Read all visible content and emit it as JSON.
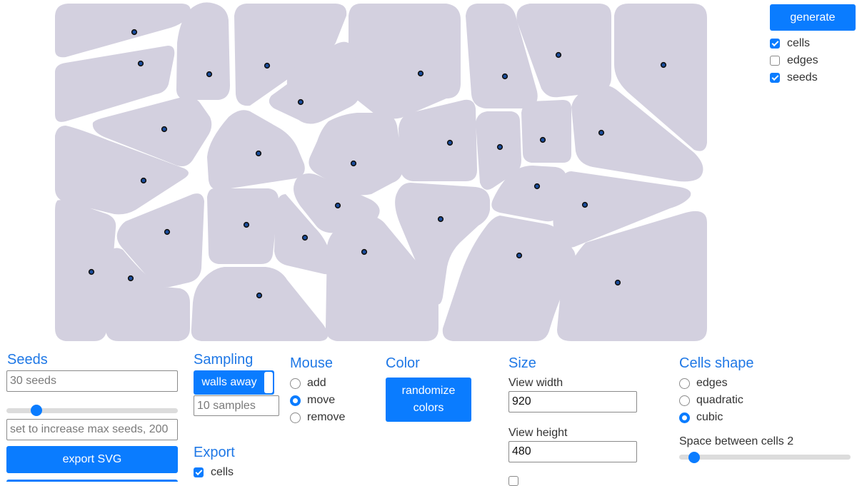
{
  "display": {
    "generate_label": "generate",
    "options": [
      {
        "label": "cells",
        "checked": true
      },
      {
        "label": "edges",
        "checked": false
      },
      {
        "label": "seeds",
        "checked": true
      }
    ]
  },
  "seeds": {
    "heading": "Seeds",
    "count_placeholder": "30 seeds",
    "slider_value": 30,
    "max_placeholder": "set to increase max seeds, 200",
    "export_svg_label": "export SVG"
  },
  "sampling": {
    "heading": "Sampling",
    "mode_label": "walls away",
    "samples_placeholder": "10 samples"
  },
  "export": {
    "heading": "Export",
    "cells_label": "cells",
    "cells_checked": true
  },
  "mouse": {
    "heading": "Mouse",
    "options": [
      {
        "label": "add",
        "selected": false
      },
      {
        "label": "move",
        "selected": true
      },
      {
        "label": "remove",
        "selected": false
      }
    ]
  },
  "color": {
    "heading": "Color",
    "randomize_label": "randomize\ncolors"
  },
  "size": {
    "heading": "Size",
    "view_width_label": "View width",
    "view_width_value": "920",
    "view_height_label": "View height",
    "view_height_value": "480"
  },
  "cells_shape": {
    "heading": "Cells shape",
    "options": [
      {
        "label": "edges",
        "selected": false
      },
      {
        "label": "quadratic",
        "selected": false
      },
      {
        "label": "cubic",
        "selected": true
      }
    ],
    "space_label": "Space between cells 2",
    "space_value": 2
  },
  "colors": {
    "accent": "#0a7cff",
    "heading": "#1f78e6",
    "cell_fill": "#d3d0df",
    "seed_fill": "#1a4d9e"
  },
  "icons": {
    "check": "checkmark-icon",
    "radio": "radio-dot-icon"
  }
}
